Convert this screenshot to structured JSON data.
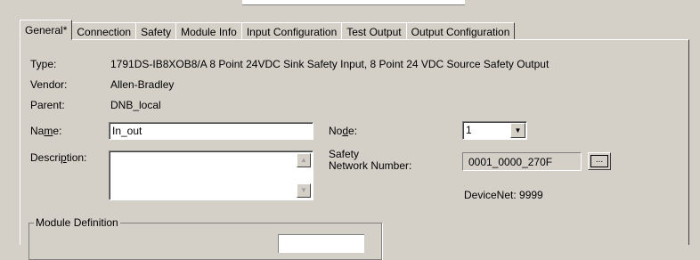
{
  "tabs": [
    {
      "label": "General*",
      "active": true
    },
    {
      "label": "Connection",
      "active": false
    },
    {
      "label": "Safety",
      "active": false
    },
    {
      "label": "Module Info",
      "active": false
    },
    {
      "label": "Input Configuration",
      "active": false
    },
    {
      "label": "Test Output",
      "active": false
    },
    {
      "label": "Output Configuration",
      "active": false
    }
  ],
  "general": {
    "type_label": "Type:",
    "type_value": "1791DS-IB8XOB8/A 8 Point 24VDC Sink Safety Input, 8 Point 24 VDC Source Safety Output",
    "vendor_label": "Vendor:",
    "vendor_value": "Allen-Bradley",
    "parent_label": "Parent:",
    "parent_value": "DNB_local",
    "name_label_pre": "Na",
    "name_label_ul": "m",
    "name_label_post": "e:",
    "name_value": "In_out",
    "description_label_pre": "Descri",
    "description_label_ul": "p",
    "description_label_post": "tion:",
    "description_value": "",
    "node_label_pre": "No",
    "node_label_ul": "d",
    "node_label_post": "e:",
    "node_value": "1",
    "safety_network_label_line1": "Safety",
    "safety_network_label_line2": "Network Number:",
    "safety_network_value": "0001_0000_270F",
    "ellipsis_label": "...",
    "devicenet_text": "DeviceNet: 9999"
  },
  "module_definition": {
    "title": "Module Definition"
  },
  "icons": {
    "scroll_up": "scroll-up-arrow-icon",
    "scroll_down": "scroll-down-arrow-icon",
    "combo_down": "dropdown-arrow-icon"
  }
}
